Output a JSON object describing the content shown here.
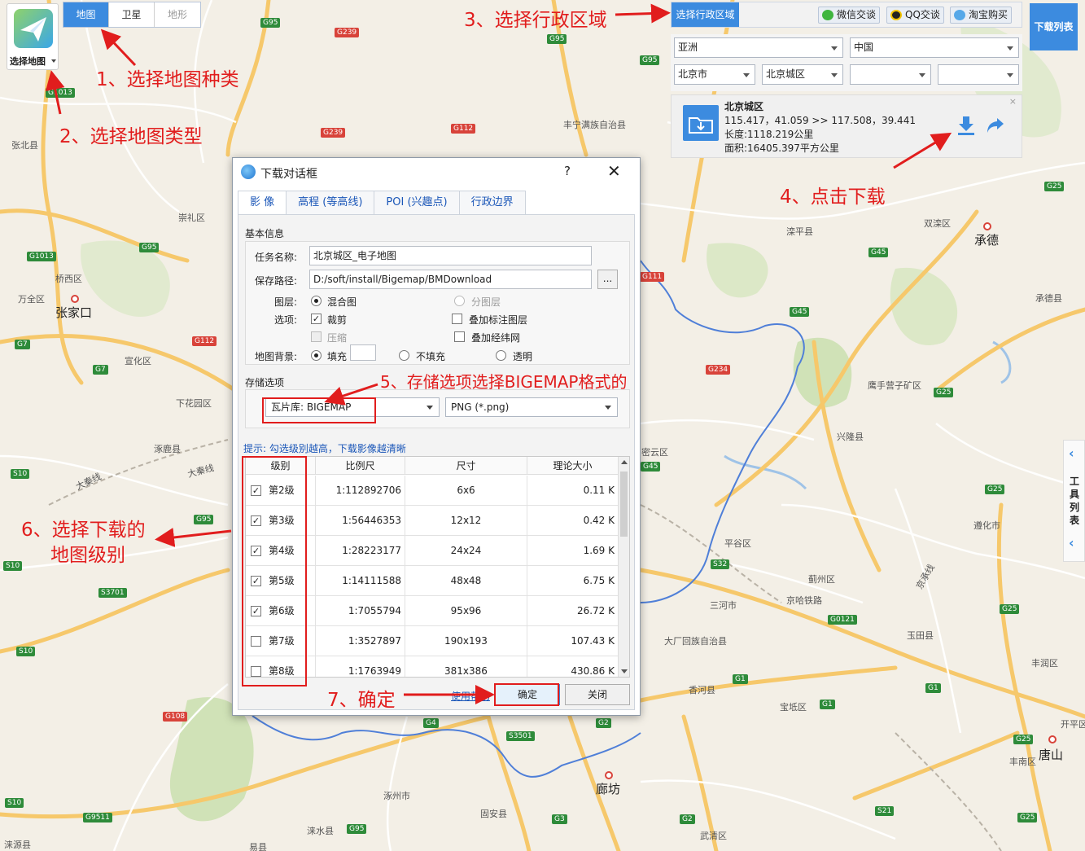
{
  "colors": {
    "accent": "#3c8bdf",
    "annotation": "#e11d1d",
    "map_land": "#f3efe6",
    "road_major": "#f6c86b",
    "road_minor": "#ffffff",
    "border": "#4f7fd8",
    "park": "#c9dfae"
  },
  "map_selector": {
    "label": "选择地图",
    "icon": "paper-plane-icon"
  },
  "map_type_tabs": [
    {
      "label": "地图",
      "active": true
    },
    {
      "label": "卫星",
      "active": false
    },
    {
      "label": "地形",
      "active": false
    }
  ],
  "region_bar": {
    "title": "选择行政区域",
    "buttons": [
      {
        "label": "微信交谈",
        "icon": "wechat-icon"
      },
      {
        "label": "QQ交谈",
        "icon": "qq-icon"
      },
      {
        "label": "淘宝购买",
        "icon": "taobao-icon"
      }
    ],
    "download_list": "下载列表"
  },
  "region_selects": {
    "continent": "亚洲",
    "country": "中国",
    "province": "北京市",
    "district": "北京城区",
    "extra1": "",
    "extra2": ""
  },
  "region_info": {
    "name": "北京城区",
    "coords": "115.417，41.059 >> 117.508，39.441",
    "length": "长度:1118.219公里",
    "area": "面积:16405.397平方公里",
    "close": "×"
  },
  "tool_strip": {
    "label": "工具列表",
    "up": "‹",
    "down": "‹"
  },
  "dialog": {
    "title": "下载对话框",
    "help": "?",
    "close": "✕",
    "tabs": [
      "影 像",
      "高程 (等高线)",
      "POI (兴趣点)",
      "行政边界"
    ],
    "basic_title": "基本信息",
    "task_label": "任务名称:",
    "task_value": "北京城区_电子地图",
    "path_label": "保存路径:",
    "path_value": "D:/soft/install/Bigemap/BMDownload",
    "browse": "...",
    "layer_label": "图层:",
    "layer_mixed": "混合图",
    "layer_split": "分图层",
    "options_label": "选项:",
    "opt_crop": "裁剪",
    "opt_overlay": "叠加标注图层",
    "opt_compress": "压缩",
    "opt_grid": "叠加经纬网",
    "bg_label": "地图背景:",
    "bg_fill": "填充",
    "bg_nofill": "不填充",
    "bg_transparent": "透明",
    "storage_title": "存储选项",
    "storage_format": "瓦片库: BIGEMAP",
    "image_format": "PNG (*.png)",
    "hint": "提示: 勾选级别越高，下载影像越清晰",
    "table": {
      "headers": [
        "级别",
        "比例尺",
        "尺寸",
        "理论大小"
      ],
      "rows": [
        {
          "checked": true,
          "level": "第2级",
          "scale": "1:112892706",
          "size": "6x6",
          "bytes": "0.11 K"
        },
        {
          "checked": true,
          "level": "第3级",
          "scale": "1:56446353",
          "size": "12x12",
          "bytes": "0.42 K"
        },
        {
          "checked": true,
          "level": "第4级",
          "scale": "1:28223177",
          "size": "24x24",
          "bytes": "1.69 K"
        },
        {
          "checked": true,
          "level": "第5级",
          "scale": "1:14111588",
          "size": "48x48",
          "bytes": "6.75 K"
        },
        {
          "checked": true,
          "level": "第6级",
          "scale": "1:7055794",
          "size": "95x96",
          "bytes": "26.72 K"
        },
        {
          "checked": false,
          "level": "第7级",
          "scale": "1:3527897",
          "size": "190x193",
          "bytes": "107.43 K"
        },
        {
          "checked": false,
          "level": "第8级",
          "scale": "1:1763949",
          "size": "381x386",
          "bytes": "430.86 K"
        }
      ]
    },
    "help_link": "使用帮助",
    "ok": "确定",
    "cancel": "关闭"
  },
  "annotations": {
    "a1": "1、选择地图种类",
    "a2": "2、选择地图类型",
    "a3": "3、选择行政区域",
    "a4": "4、点击下载",
    "a5": "5、存储选项选择BIGEMAP格式的",
    "a6_line1": "6、选择下载的",
    "a6_line2": "地图级别",
    "a7": "7、确定"
  },
  "map_labels": {
    "places": [
      {
        "t": "张北县"
      },
      {
        "t": "崇礼区"
      },
      {
        "t": "桥西区"
      },
      {
        "t": "万全区"
      },
      {
        "t": "张家口",
        "big": true
      },
      {
        "t": "宣化区"
      },
      {
        "t": "下花园区"
      },
      {
        "t": "涿鹿县"
      },
      {
        "t": "丰宁满族自治县"
      },
      {
        "t": "滦平县"
      },
      {
        "t": "双滦区"
      },
      {
        "t": "承德",
        "big": true
      },
      {
        "t": "承德县"
      },
      {
        "t": "鹰手营子矿区"
      },
      {
        "t": "兴隆县"
      },
      {
        "t": "密云区"
      },
      {
        "t": "平谷区"
      },
      {
        "t": "遵化市"
      },
      {
        "t": "蓟州区"
      },
      {
        "t": "三河市"
      },
      {
        "t": "京哈铁路"
      },
      {
        "t": "大厂回族自治县"
      },
      {
        "t": "玉田县"
      },
      {
        "t": "丰润区"
      },
      {
        "t": "香河县"
      },
      {
        "t": "宝坻区"
      },
      {
        "t": "开平区"
      },
      {
        "t": "唐山",
        "big": true
      },
      {
        "t": "丰南区"
      },
      {
        "t": "廊坊",
        "big": true
      },
      {
        "t": "涿州市"
      },
      {
        "t": "固安县"
      },
      {
        "t": "涞水县"
      },
      {
        "t": "涞源县"
      },
      {
        "t": "易县"
      },
      {
        "t": "武清区"
      },
      {
        "t": "大秦线"
      },
      {
        "t": "大秦线"
      },
      {
        "t": "京承线"
      }
    ],
    "shields": [
      {
        "t": "G95",
        "c": "g"
      },
      {
        "t": "G239",
        "c": "r"
      },
      {
        "t": "G95",
        "c": "g"
      },
      {
        "t": "G95",
        "c": "g"
      },
      {
        "t": "G1013",
        "c": "g"
      },
      {
        "t": "G239",
        "c": "r"
      },
      {
        "t": "G112",
        "c": "r"
      },
      {
        "t": "G1013",
        "c": "g"
      },
      {
        "t": "G95",
        "c": "g"
      },
      {
        "t": "G7",
        "c": "g"
      },
      {
        "t": "G7",
        "c": "g"
      },
      {
        "t": "G112",
        "c": "r"
      },
      {
        "t": "S10",
        "c": "g"
      },
      {
        "t": "G95",
        "c": "g"
      },
      {
        "t": "S10",
        "c": "g"
      },
      {
        "t": "S3701",
        "c": "g"
      },
      {
        "t": "S10",
        "c": "g"
      },
      {
        "t": "G108",
        "c": "r"
      },
      {
        "t": "S10",
        "c": "g"
      },
      {
        "t": "G9511",
        "c": "g"
      },
      {
        "t": "G95",
        "c": "g"
      },
      {
        "t": "G111",
        "c": "r"
      },
      {
        "t": "G45",
        "c": "g"
      },
      {
        "t": "G45",
        "c": "g"
      },
      {
        "t": "G234",
        "c": "r"
      },
      {
        "t": "G25",
        "c": "g"
      },
      {
        "t": "G25",
        "c": "g"
      },
      {
        "t": "G45",
        "c": "g"
      },
      {
        "t": "G25",
        "c": "g"
      },
      {
        "t": "S32",
        "c": "g"
      },
      {
        "t": "G25",
        "c": "g"
      },
      {
        "t": "G0121",
        "c": "g"
      },
      {
        "t": "G1",
        "c": "g"
      },
      {
        "t": "G1",
        "c": "g"
      },
      {
        "t": "G1",
        "c": "g"
      },
      {
        "t": "G4",
        "c": "g"
      },
      {
        "t": "S3501",
        "c": "g"
      },
      {
        "t": "G2",
        "c": "g"
      },
      {
        "t": "G3",
        "c": "g"
      },
      {
        "t": "G2",
        "c": "g"
      },
      {
        "t": "G25",
        "c": "g"
      },
      {
        "t": "S21",
        "c": "g"
      },
      {
        "t": "G25",
        "c": "g"
      }
    ]
  }
}
